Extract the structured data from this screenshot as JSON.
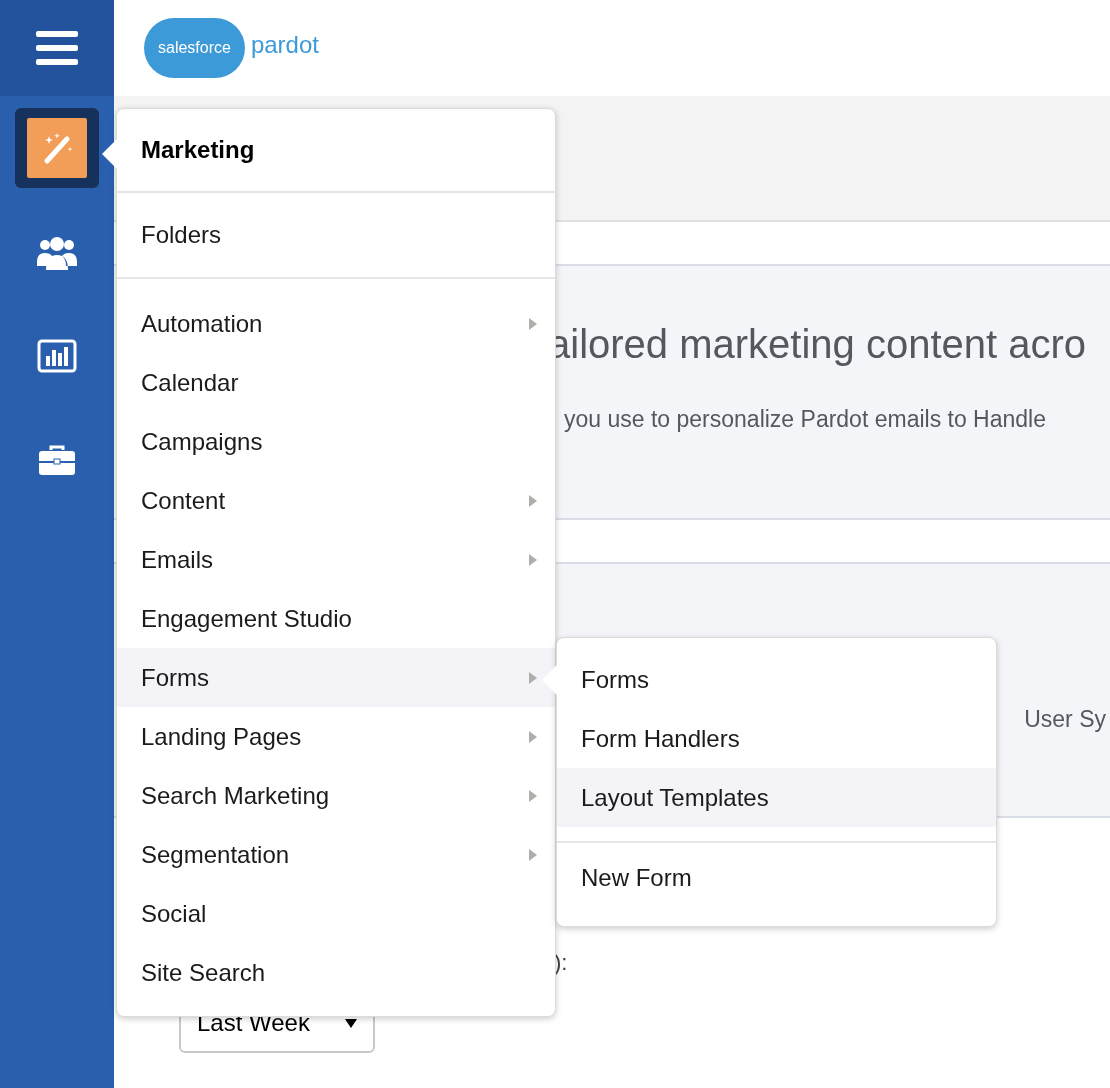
{
  "sidebar": {
    "items": [
      {
        "kind": "marketing",
        "selected": true
      },
      {
        "kind": "people",
        "selected": false
      },
      {
        "kind": "reports",
        "selected": false
      },
      {
        "kind": "admin",
        "selected": false
      }
    ]
  },
  "header": {
    "logo_cloud_text": "salesforce",
    "logo_product": "pardot"
  },
  "content": {
    "heading_fragment": "ailored marketing content acro",
    "text_fragment": "you use to personalize Pardot emails to Handle",
    "text2_fragment": "User Sy",
    "label_fragment": "):",
    "dropdown_value": "Last Week"
  },
  "menu": {
    "title": "Marketing",
    "top_item": "Folders",
    "items": [
      {
        "label": "Automation",
        "has_submenu": true,
        "selected": false
      },
      {
        "label": "Calendar",
        "has_submenu": false,
        "selected": false
      },
      {
        "label": "Campaigns",
        "has_submenu": false,
        "selected": false
      },
      {
        "label": "Content",
        "has_submenu": true,
        "selected": false
      },
      {
        "label": "Emails",
        "has_submenu": true,
        "selected": false
      },
      {
        "label": "Engagement Studio",
        "has_submenu": false,
        "selected": false
      },
      {
        "label": "Forms",
        "has_submenu": true,
        "selected": true
      },
      {
        "label": "Landing Pages",
        "has_submenu": true,
        "selected": false
      },
      {
        "label": "Search Marketing",
        "has_submenu": true,
        "selected": false
      },
      {
        "label": "Segmentation",
        "has_submenu": true,
        "selected": false
      },
      {
        "label": "Social",
        "has_submenu": false,
        "selected": false
      },
      {
        "label": "Site Search",
        "has_submenu": false,
        "selected": false
      }
    ]
  },
  "submenu": {
    "items": [
      {
        "label": "Forms",
        "selected": false
      },
      {
        "label": "Form Handlers",
        "selected": false
      },
      {
        "label": "Layout Templates",
        "selected": true
      }
    ],
    "action": "New Form"
  }
}
